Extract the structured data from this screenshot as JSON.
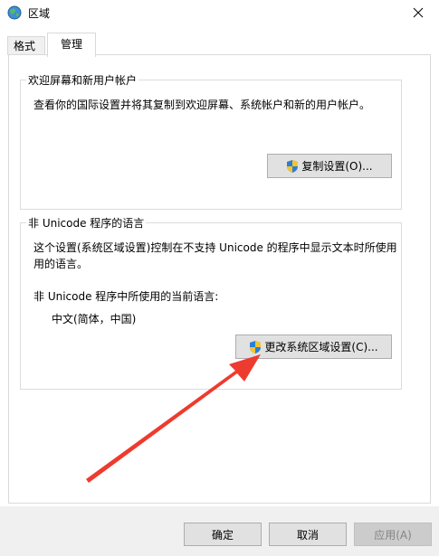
{
  "window": {
    "title": "区域",
    "close_icon": "close-icon",
    "app_icon": "globe-icon"
  },
  "tabs": [
    {
      "label": "格式",
      "active": false
    },
    {
      "label": "管理",
      "active": true
    }
  ],
  "welcome_group": {
    "title": "欢迎屏幕和新用户帐户",
    "description": "查看你的国际设置并将其复制到欢迎屏幕、系统帐户和新的用户帐户。",
    "copy_button": "复制设置(O)..."
  },
  "unicode_group": {
    "title": "非 Unicode 程序的语言",
    "description_line1": "这个设置(系统区域设置)控制在不支持 Unicode 的程序中显示文本时所使用",
    "description_line2": "用的语言。",
    "current_label": "非 Unicode 程序中所使用的当前语言:",
    "current_value": "中文(简体，中国)",
    "change_button": "更改系统区域设置(C)..."
  },
  "footer": {
    "ok": "确定",
    "cancel": "取消",
    "apply": "应用(A)"
  },
  "colors": {
    "accent": "#0078d7",
    "arrow": "#ee3b2f"
  }
}
